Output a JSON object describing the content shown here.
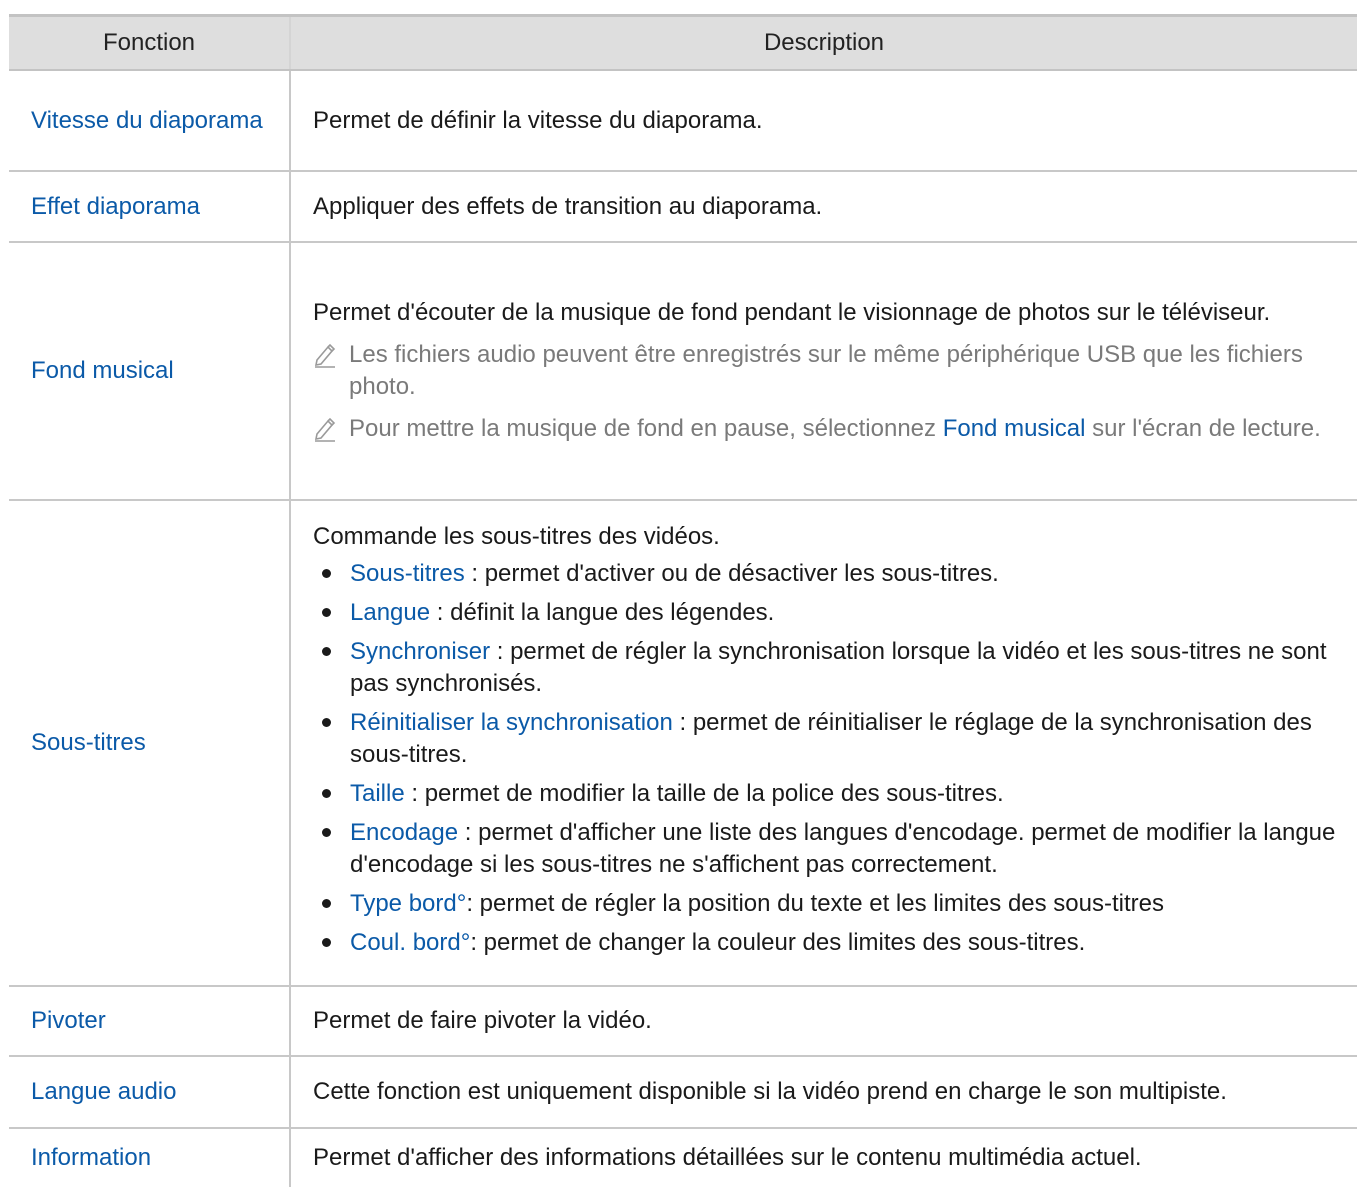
{
  "header": {
    "function_col": "Fonction",
    "description_col": "Description"
  },
  "rows": {
    "vitesse": {
      "function": "Vitesse du diaporama",
      "description": "Permet de définir la vitesse du diaporama."
    },
    "effet": {
      "function": "Effet diaporama",
      "description": "Appliquer des effets de transition au diaporama."
    },
    "fond": {
      "function": "Fond musical",
      "description": "Permet d'écouter de la musique de fond pendant le visionnage de photos sur le téléviseur.",
      "note1": "Les fichiers audio peuvent être enregistrés sur le même périphérique USB que les fichiers photo.",
      "note2_before": "Pour mettre la musique de fond en pause, sélectionnez ",
      "note2_link": "Fond musical",
      "note2_after": " sur l'écran de lecture."
    },
    "sous_titres": {
      "function": "Sous-titres",
      "description": "Commande les sous-titres des vidéos.",
      "items": [
        {
          "term": "Sous-titres",
          "text": " : permet d'activer ou de désactiver les sous-titres."
        },
        {
          "term": "Langue",
          "text": " : définit la langue des légendes."
        },
        {
          "term": "Synchroniser",
          "text": " : permet de régler la synchronisation lorsque la vidéo et les sous-titres ne sont pas synchronisés."
        },
        {
          "term": "Réinitialiser la synchronisation",
          "text": " : permet de réinitialiser le réglage de la synchronisation des sous-titres."
        },
        {
          "term": "Taille",
          "text": " : permet de modifier la taille de la police des sous-titres."
        },
        {
          "term": "Encodage",
          "text": " : permet d'afficher une liste des langues d'encodage. permet de modifier la langue d'encodage si les sous-titres ne s'affichent pas correctement."
        },
        {
          "term": "Type bord°",
          "text": ": permet de régler la position du texte et les limites des sous-titres"
        },
        {
          "term": "Coul. bord°",
          "text": ": permet de changer la couleur des limites des sous-titres."
        }
      ]
    },
    "pivoter": {
      "function": "Pivoter",
      "description": "Permet de faire pivoter la vidéo."
    },
    "langue_audio": {
      "function": "Langue audio",
      "description": "Cette fonction est uniquement disponible si la vidéo prend en charge le son multipiste."
    },
    "information": {
      "function": "Information",
      "description": "Permet d'afficher des informations détaillées sur le contenu multimédia actuel."
    }
  },
  "colors": {
    "link_blue": "#0b5aa8",
    "header_bg": "#dedede",
    "note_gray": "#7a7a7a"
  },
  "icons": {
    "note": "pencil-note-icon",
    "bullet": "bullet-dot-icon"
  }
}
